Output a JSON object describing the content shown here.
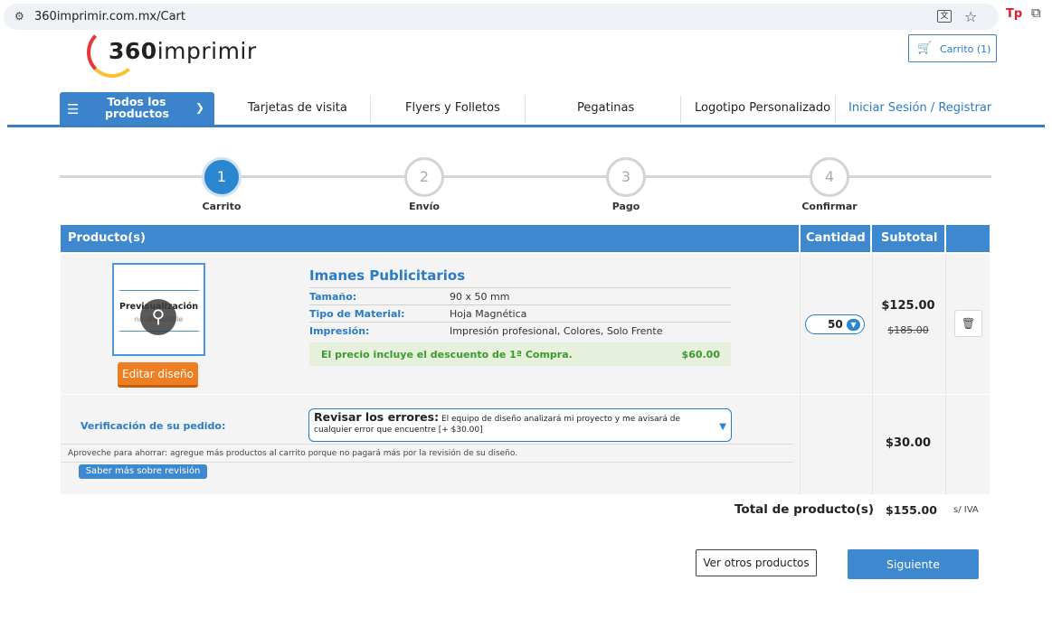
{
  "browser": {
    "url": "360imprimir.com.mx/Cart",
    "site_icon": "tune-icon",
    "tp_label": "Tp"
  },
  "header": {
    "logo_number": "360",
    "logo_word": "imprimir",
    "cart_label": "Carrito (1)"
  },
  "nav": {
    "all_products": "Todos los productos",
    "items": [
      "Tarjetas de visita",
      "Flyers y Folletos",
      "Pegatinas",
      "Logotipo Personalizado"
    ],
    "login": "Iniciar Sesión / Registrar"
  },
  "steps": [
    {
      "number": "1",
      "label": "Carrito",
      "active": true
    },
    {
      "number": "2",
      "label": "Envío",
      "active": false
    },
    {
      "number": "3",
      "label": "Pago",
      "active": false
    },
    {
      "number": "4",
      "label": "Confirmar",
      "active": false
    }
  ],
  "table": {
    "headers": {
      "product": "Producto(s)",
      "quantity": "Cantidad",
      "subtotal": "Subtotal"
    }
  },
  "product": {
    "preview_title": "Previsualización",
    "preview_sub": "no disponible",
    "edit_label": "Editar diseño",
    "name": "Imanes Publicitarios",
    "specs": [
      {
        "key": "Tamaño:",
        "value": "90 x 50 mm"
      },
      {
        "key": "Tipo de Material:",
        "value": "Hoja Magnética"
      },
      {
        "key": "Impresión:",
        "value": "Impresión profesional, Colores, Solo Frente"
      }
    ],
    "discount_text": "El precio incluye el descuento de 1ª Compra.",
    "discount_value": "$60.00",
    "quantity": "50",
    "price": "$125.00",
    "old_price": "$185.00"
  },
  "review": {
    "label": "Verificación de su pedido:",
    "select_title": "Revisar los errores:",
    "select_text": " El equipo de diseño analizará mi proyecto y me avisará de cualquier error que encuentre [+ $30.00]",
    "note": "Aproveche para ahorrar: agregue más productos al carrito porque no pagará más por la revisión de su diseño.",
    "learn_more": "Saber más sobre revisión",
    "price": "$30.00"
  },
  "totals": {
    "label": "Total de producto(s)",
    "value": "$155.00",
    "tax_note": "s/ IVA"
  },
  "actions": {
    "other_products": "Ver otros productos",
    "next": "Siguiente"
  },
  "colors": {
    "brand_blue": "#3e88cf",
    "edit_orange": "#ef7d22",
    "discount_green": "#3a9a2e"
  }
}
